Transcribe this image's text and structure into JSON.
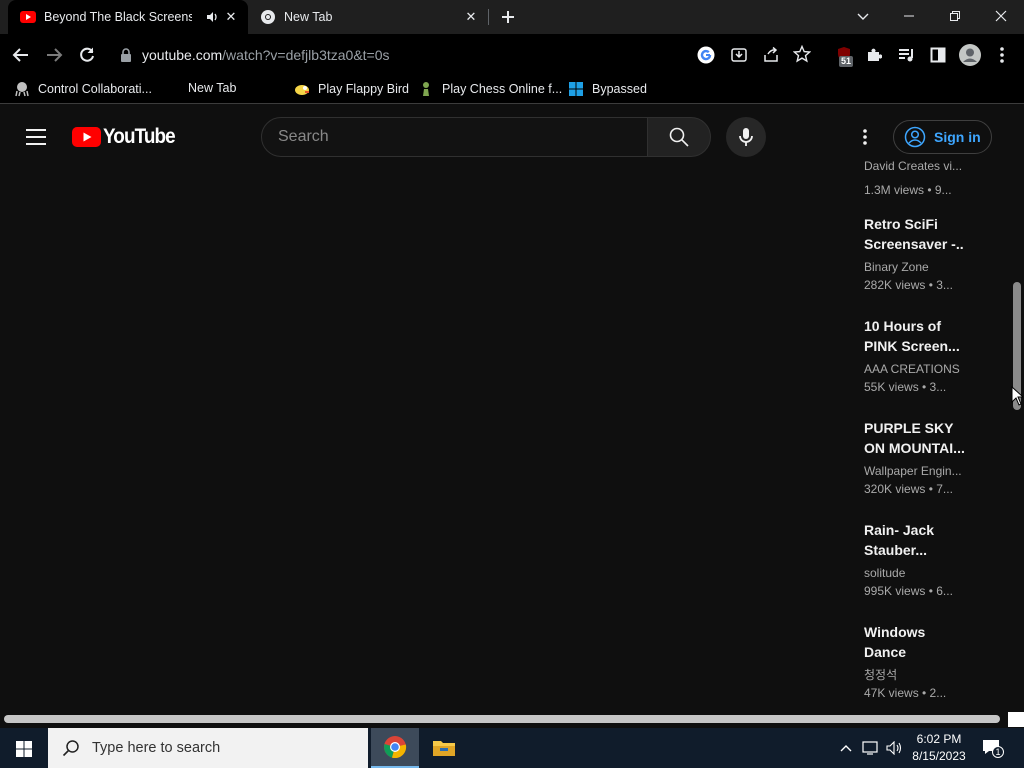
{
  "browser": {
    "tabs": [
      {
        "title": "Beyond The Black Screens...",
        "active": true
      },
      {
        "title": "New Tab",
        "active": false
      }
    ],
    "url_domain": "youtube.com",
    "url_path": "/watch?v=defjlb3tza0&t=0s",
    "extension_badge": "51"
  },
  "bookmarks": [
    {
      "label": "Control Collaborati...",
      "icon": "octopus-icon"
    },
    {
      "label": "New Tab",
      "icon": "none"
    },
    {
      "label": "Play Flappy Bird",
      "icon": "flappy-bird-icon"
    },
    {
      "label": "Play Chess Online f...",
      "icon": "chess-pawn-icon"
    },
    {
      "label": "Bypassed",
      "icon": "windows-icon"
    }
  ],
  "youtube": {
    "logo_text": "YouTube",
    "search_placeholder": "Search",
    "signin_label": "Sign in",
    "brand_red": "#ff0000",
    "link_blue": "#3ea6ff"
  },
  "recommendations": [
    {
      "title_lines": [
        "",
        ""
      ],
      "channel": "David Creates vi...",
      "meta": "1.3M views  • 9..."
    },
    {
      "title_lines": [
        "Retro SciFi",
        "Screensaver -..."
      ],
      "channel": "Binary Zone",
      "meta": "282K views  • 3..."
    },
    {
      "title_lines": [
        "10 Hours of",
        "PINK Screen..."
      ],
      "channel": "AAA CREATIONS",
      "meta": "55K views  • 3..."
    },
    {
      "title_lines": [
        "PURPLE SKY",
        "ON MOUNTAI..."
      ],
      "channel": "Wallpaper Engin...",
      "meta": "320K views  • 7..."
    },
    {
      "title_lines": [
        "Rain- Jack",
        "Stauber..."
      ],
      "channel": "solitude",
      "meta": "995K views  • 6..."
    },
    {
      "title_lines": [
        "Windows",
        "Dance"
      ],
      "channel": "청정석",
      "meta": "47K views  • 2..."
    }
  ],
  "taskbar": {
    "search_placeholder": "Type here to search",
    "time": "6:02 PM",
    "date": "8/15/2023",
    "notification_count": "1"
  }
}
